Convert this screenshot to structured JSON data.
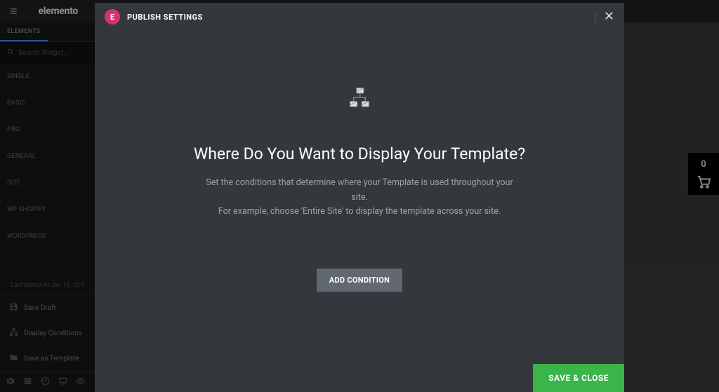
{
  "topbar": {
    "brand": "elemento"
  },
  "sidebar": {
    "tabs": [
      {
        "label": "ELEMENTS",
        "active": true
      },
      {
        "label": "",
        "active": false
      }
    ],
    "search_placeholder": "Search Widget...",
    "categories": [
      "SINGLE",
      "BASIC",
      "PRO",
      "GENERAL",
      "SITE",
      "WP SHOPIFY",
      "WORDPRESS"
    ],
    "last_edited": "Last edited on Jan 19, 16:5",
    "save_options": [
      {
        "icon": "save-icon",
        "label": "Save Draft"
      },
      {
        "icon": "conditions-icon",
        "label": "Display Conditions"
      },
      {
        "icon": "folder-icon",
        "label": "Save as Template"
      }
    ]
  },
  "cart": {
    "count": "0"
  },
  "modal": {
    "title": "PUBLISH SETTINGS",
    "heading": "Where Do You Want to Display Your Template?",
    "desc_line1": "Set the conditions that determine where your Template is used throughout your site.",
    "desc_line2": "For example, choose 'Entire Site' to display the template across your site.",
    "add_condition": "ADD CONDITION",
    "save_close": "SAVE & CLOSE"
  }
}
